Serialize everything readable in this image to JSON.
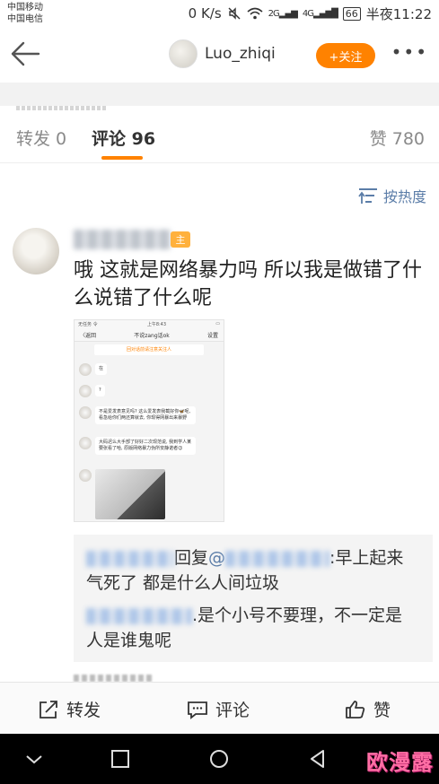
{
  "status_bar": {
    "carrier1": "中国移动",
    "carrier2": "中国电信",
    "speed": "0 K/s",
    "signal1": "2G",
    "signal2": "4G",
    "battery": "66",
    "time": "半夜11:22"
  },
  "header": {
    "username": "Luo_zhiqi",
    "follow_label": "+关注",
    "more_label": "•••"
  },
  "tabs": {
    "repost": "转发 0",
    "comments": "评论 96",
    "likes": "赞 780"
  },
  "sort": {
    "label": "按热度"
  },
  "comment": {
    "badge": "主",
    "text": "哦 这就是网络暴力吗 所以我是做错了什么说错了什么呢"
  },
  "embedded_screenshot": {
    "status_left": "无任务 令",
    "status_time": "上午8:43",
    "back": "〈返回",
    "title": "不说zang话ok",
    "settings": "设置",
    "hint": "回对话前请注意关注人",
    "messages": [
      {
        "text": "在"
      },
      {
        "text": "?"
      },
      {
        "text": "不是爱发表意见吗? 这么爱发表我截好你🦋呢, 看急给你们两还算就去, 你现得网暴出来暴野"
      },
      {
        "text": "大码迟么大手部了好好二次现范说, 我到学人某要张看了哈, 原版网络暴力伪所安静诺者😉"
      }
    ]
  },
  "replies": [
    {
      "verb": "回复",
      "at": "@",
      "text": ":早上起来气死了 都是什么人间垃圾"
    },
    {
      "text": ".是个小号不要理，不一定是人是谁鬼呢"
    }
  ],
  "actions": {
    "repost": "转发",
    "comment": "评论",
    "like": "赞"
  },
  "watermark": "欧漫露",
  "colors": {
    "accent": "#ff8200",
    "link": "#5b7da8"
  }
}
